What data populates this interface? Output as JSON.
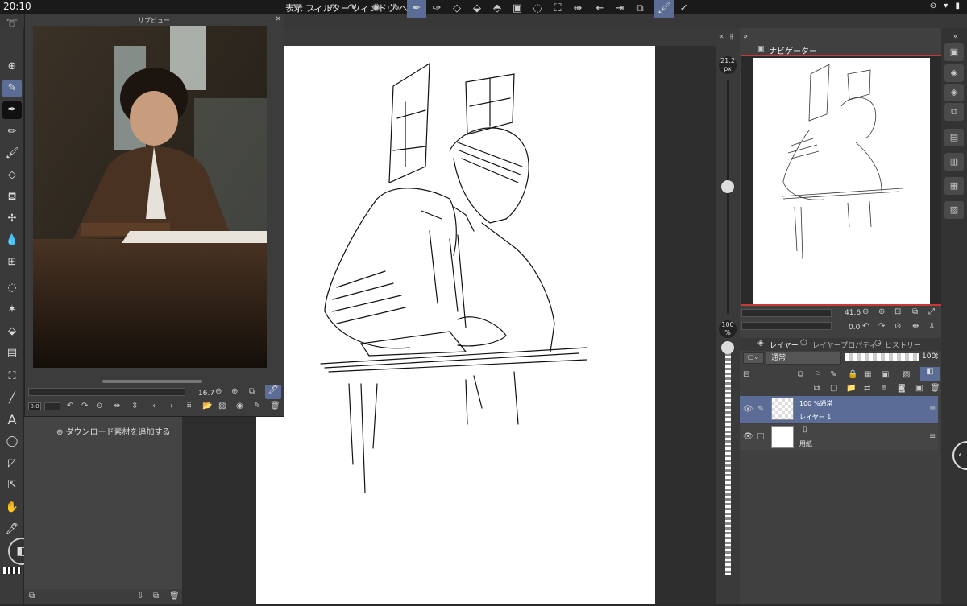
{
  "status": {
    "time": "20:10",
    "icons": "⊙ ▾ ▮"
  },
  "menu": [
    "表示",
    "フィルター",
    "ウィンドウ",
    "ヘルプ"
  ],
  "subview": {
    "title": "サブビュー",
    "zoom": "16.7",
    "angle": "0.0"
  },
  "subtool": {
    "download_label": "ダウンロード素材を追加する"
  },
  "zoom_slider": {
    "size_value": "21.2",
    "size_unit": "px",
    "opacity_value": "100",
    "opacity_unit": "%"
  },
  "navigator": {
    "tab": "ナビゲーター",
    "zoom": "41.6",
    "rotation": "0.0"
  },
  "layer_panel": {
    "tabs": [
      "レイヤー",
      "レイヤープロパティ",
      "ヒストリー"
    ],
    "blend_mode": "通常",
    "opacity": "100",
    "layers": [
      {
        "top_label": "100 %通常",
        "name": "レイヤー 1",
        "selected": true
      },
      {
        "top_label": "",
        "name": "用紙",
        "selected": false
      }
    ]
  },
  "colors": {
    "accent": "#5b6d96",
    "navigator_frame": "#c83a3a",
    "paper": "#ffffff"
  }
}
